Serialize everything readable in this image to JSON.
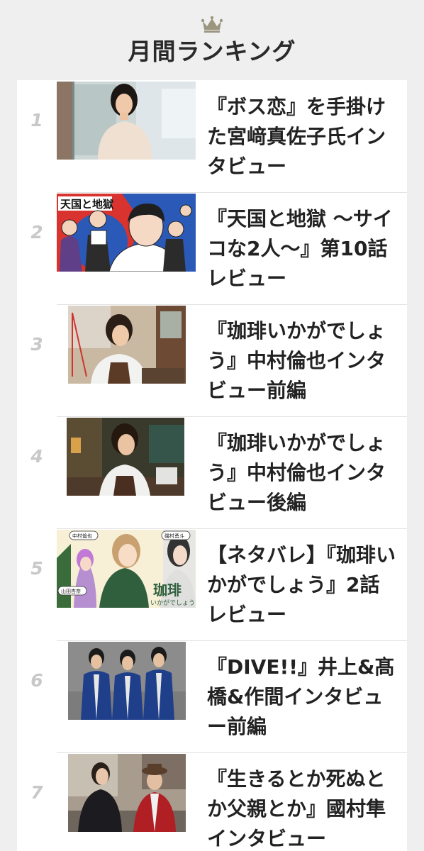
{
  "header": {
    "title": "月間ランキング",
    "icon": "crown-icon",
    "accent_color": "#9a9680"
  },
  "ranking": {
    "items": [
      {
        "rank": "1",
        "title": "『ボス恋』を手掛けた宮﨑真佐子氏インタビュー"
      },
      {
        "rank": "2",
        "title": "『天国と地獄 ～サイコな2人～』第10話レビュー"
      },
      {
        "rank": "3",
        "title": "『珈琲いかがでしょう』中村倫也インタビュー前編"
      },
      {
        "rank": "4",
        "title": "『珈琲いかがでしょう』中村倫也インタビュー後編"
      },
      {
        "rank": "5",
        "title": "【ネタバレ】『珈琲いかがでしょう』2話レビュー"
      },
      {
        "rank": "6",
        "title": "『DIVE!!』井上&髙橋&作間インタビュー前編"
      },
      {
        "rank": "7",
        "title": "『生きるとか死ぬとか父親とか』國村隼インタビュー"
      }
    ]
  },
  "thumbnails": {
    "item2_text": "天国と地獄",
    "item5_names": [
      "中村倫也",
      "山田杏奈",
      "磯村勇斗"
    ],
    "item5_logo": "珈琲",
    "item5_logo_sub": "いかがでしょう"
  }
}
